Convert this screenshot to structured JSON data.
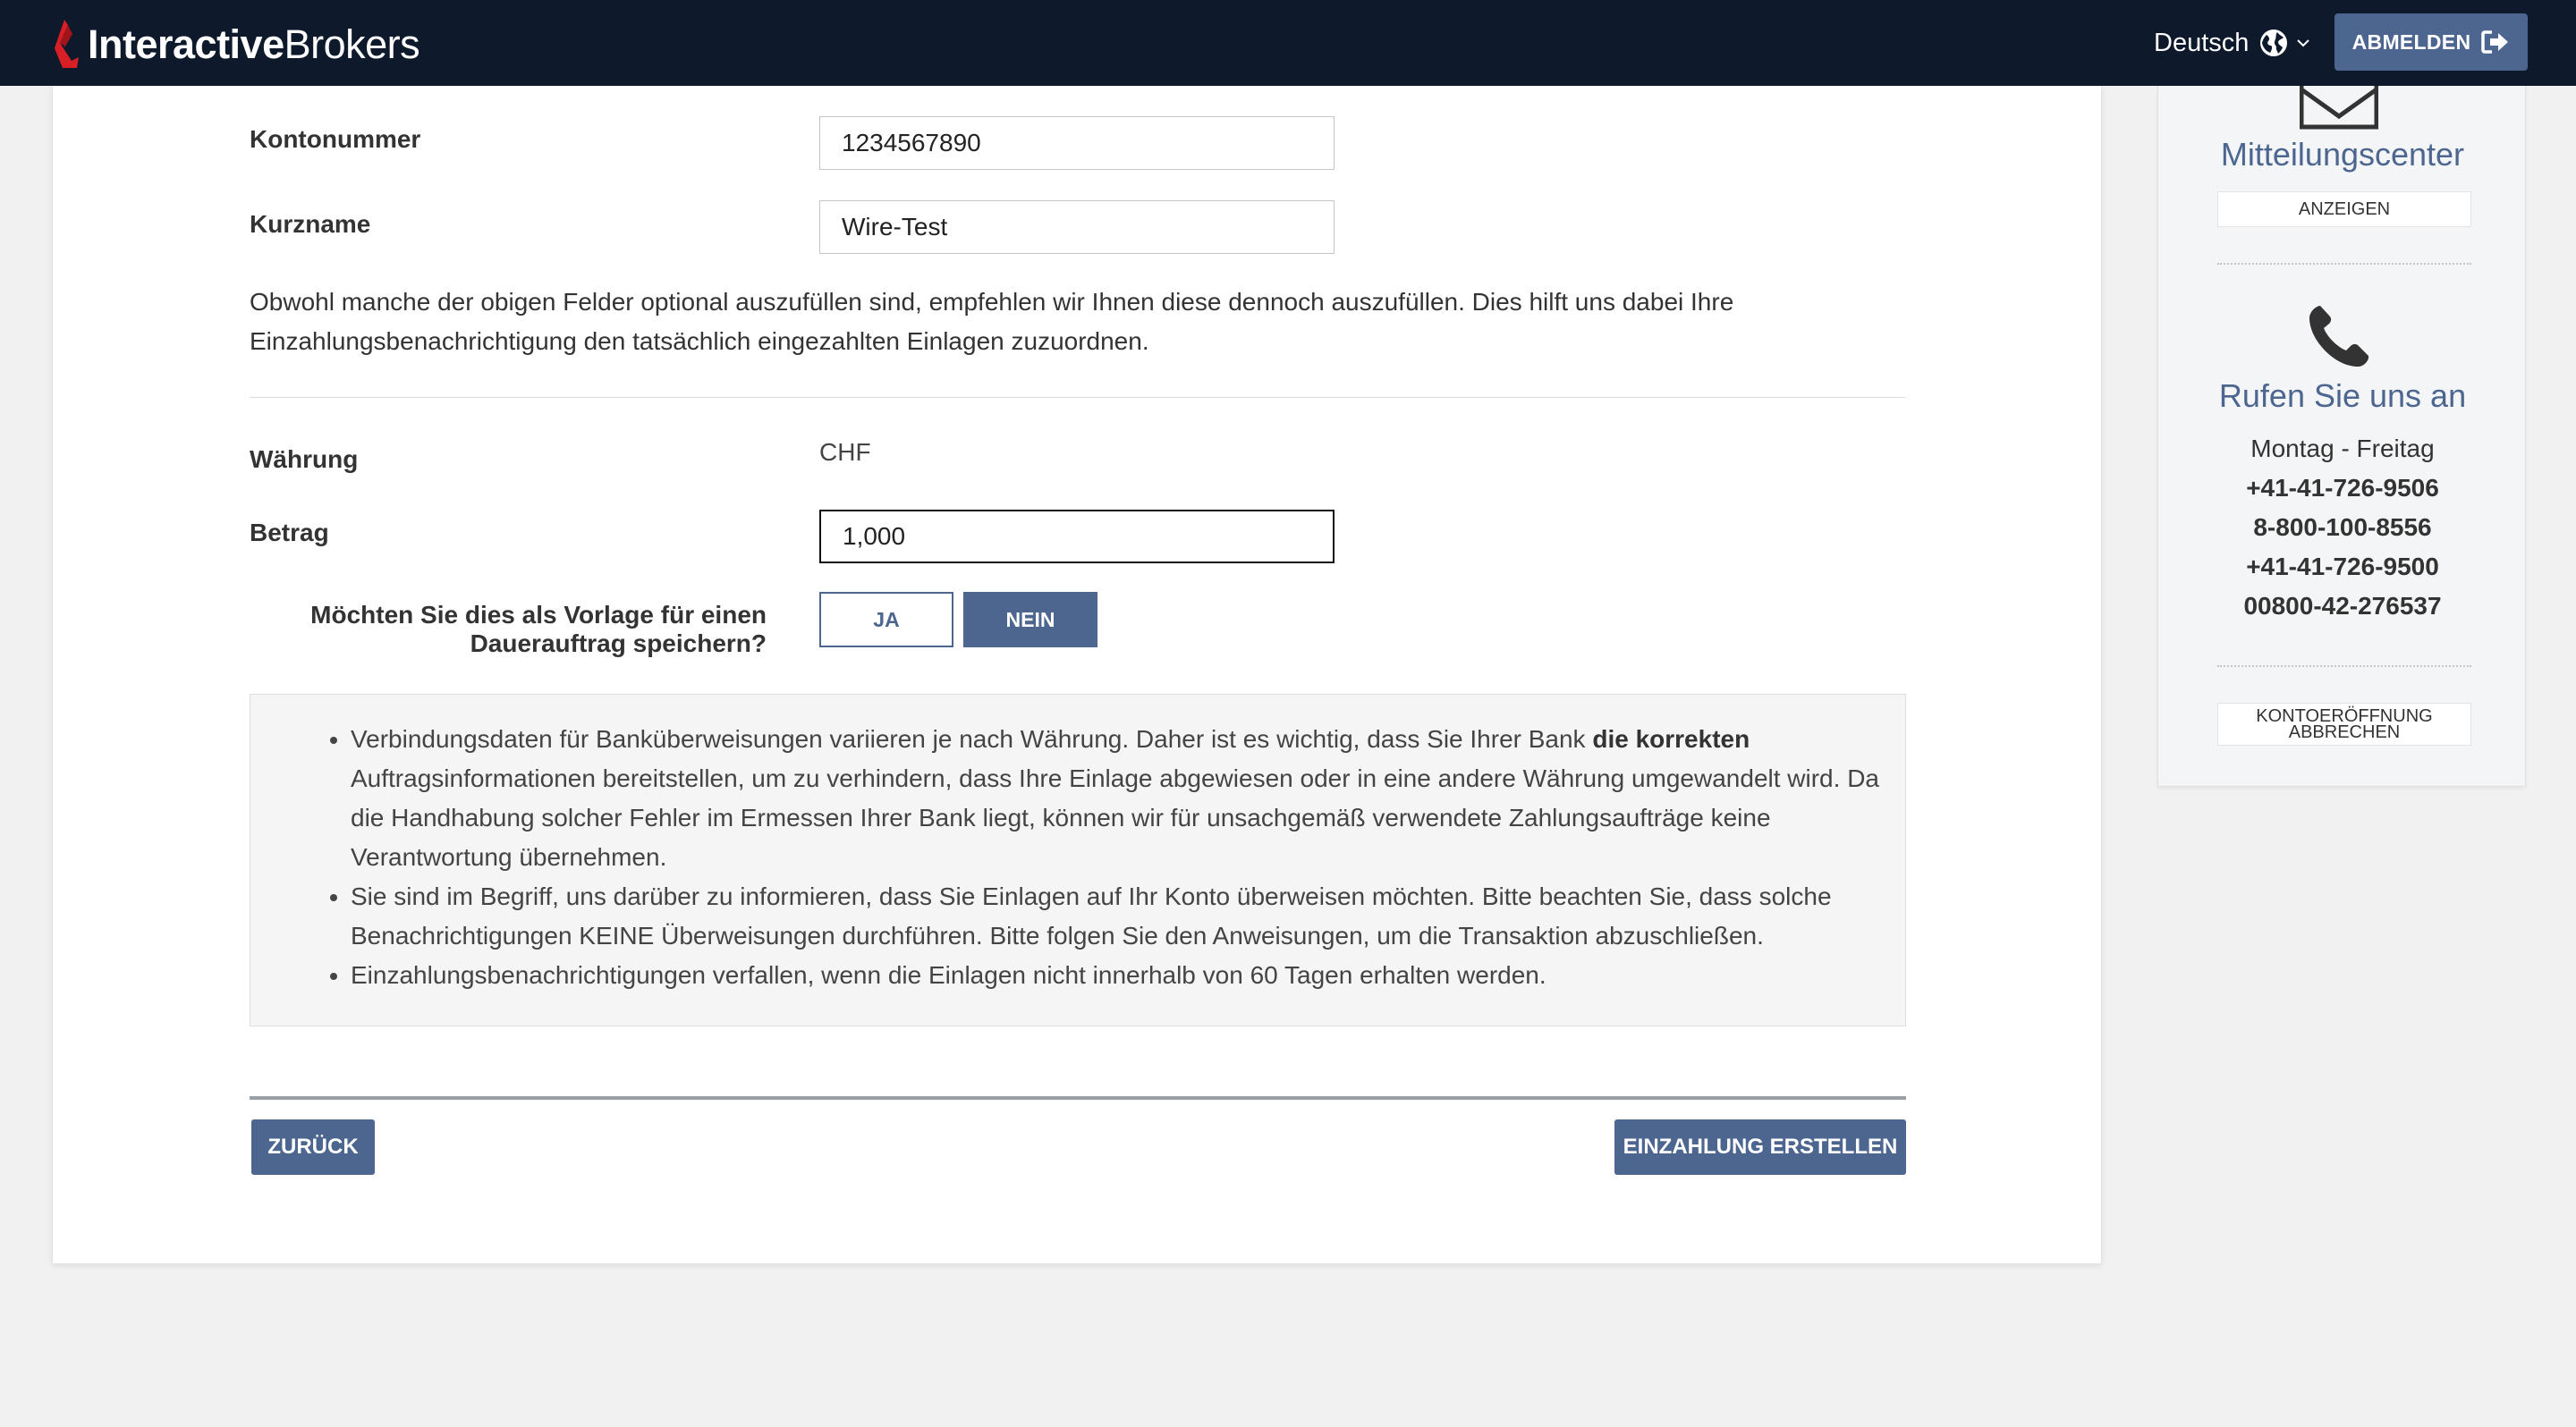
{
  "header": {
    "logo": {
      "bold": "Interactive",
      "light": "Brokers"
    },
    "language": "Deutsch",
    "logout_label": "ABMELDEN"
  },
  "form": {
    "account_number_label": "Kontonummer",
    "account_number_value": "1234567890",
    "short_name_label": "Kurzname",
    "short_name_value": "Wire-Test",
    "note": "Obwohl manche der obigen Felder optional auszufüllen sind, empfehlen wir Ihnen diese dennoch auszufüllen. Dies hilft uns dabei Ihre Einzahlungsbenachrichtigung den tatsächlich eingezahlten Einlagen zuzuordnen.",
    "currency_label": "Währung",
    "currency_value": "CHF",
    "amount_label": "Betrag",
    "amount_value": "1,000",
    "template_question": "Möchten Sie dies als Vorlage für einen Dauerauftrag speichern?",
    "yes_label": "JA",
    "no_label": "NEIN",
    "selected_option": "NEIN"
  },
  "info": {
    "item1_pre": "Verbindungsdaten für Banküberweisungen variieren je nach Währung. Daher ist es wichtig, dass Sie Ihrer Bank ",
    "item1_bold": "die korrekten",
    "item1_post": " Auftragsinformationen bereitstellen, um zu verhindern, dass Ihre Einlage abgewiesen oder in eine andere Währung umgewandelt wird. Da die Handhabung solcher Fehler im Ermessen Ihrer Bank liegt, können wir für unsachgemäß verwendete Zahlungsaufträge keine Verantwortung übernehmen.",
    "item2": "Sie sind im Begriff, uns darüber zu informieren, dass Sie Einlagen auf Ihr Konto überweisen möchten. Bitte beachten Sie, dass solche Benachrichtigungen KEINE Überweisungen durchführen. Bitte folgen Sie den Anweisungen, um die Transaktion abzuschließen.",
    "item3": "Einzahlungsbenachrichtigungen verfallen, wenn die Einlagen nicht innerhalb von 60 Tagen erhalten werden."
  },
  "actions": {
    "back_label": "ZURÜCK",
    "submit_label": "EINZAHLUNG ERSTELLEN"
  },
  "sidebar": {
    "message_center_title": "Mitteilungscenter",
    "view_label": "ANZEIGEN",
    "call_title": "Rufen Sie uns an",
    "hours": "Montag - Freitag",
    "phones": [
      "+41-41-726-9506",
      "8-800-100-8556",
      "+41-41-726-9500",
      "00800-42-276537"
    ],
    "cancel_line1": "KONTOERÖFFNUNG",
    "cancel_line2": "ABBRECHEN"
  },
  "colors": {
    "navbar": "#0e1a2c",
    "accent": "#4c6690",
    "logo_red": "#d81f26"
  }
}
